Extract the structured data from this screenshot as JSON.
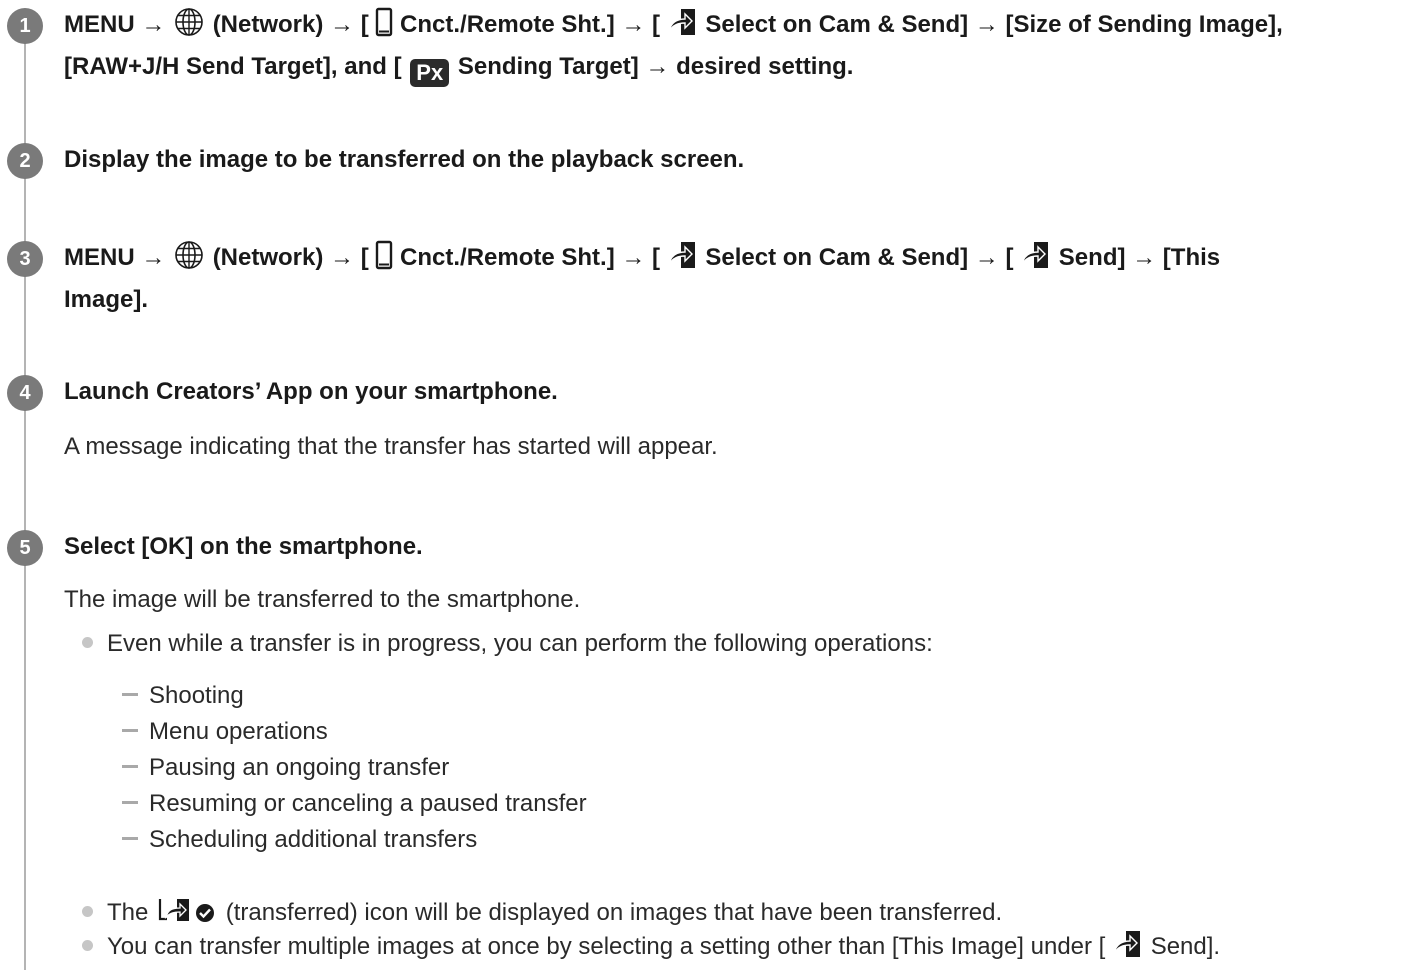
{
  "steps": [
    {
      "number": "1",
      "line1": {
        "t1": "MENU →",
        "t2": "(Network) → [",
        "t3": "Cnct./Remote Sht.] → [",
        "t4": "Select on Cam & Send] → [Size of Sending Image],"
      },
      "line2": {
        "t1": "[RAW+J/H Send Target], and [",
        "badge": "Px",
        "t2": "Sending Target] → desired setting."
      }
    },
    {
      "number": "2",
      "heading": "Display the image to be transferred on the playback screen."
    },
    {
      "number": "3",
      "line1": {
        "t1": "MENU →",
        "t2": "(Network) → [",
        "t3": "Cnct./Remote Sht.] → [",
        "t4": "Select on Cam & Send] → [",
        "t5": "Send] → [This"
      },
      "line2": "Image]."
    },
    {
      "number": "4",
      "heading": "Launch Creators’ App on your smartphone.",
      "body": "A message indicating that the transfer has started will appear."
    },
    {
      "number": "5",
      "heading": "Select [OK] on the smartphone.",
      "body": "The image will be transferred to the smartphone.",
      "bullet1": "Even while a transfer is in progress, you can perform the following operations:",
      "sub_items": [
        "Shooting",
        "Menu operations",
        "Pausing an ongoing transfer",
        "Resuming or canceling a paused transfer",
        "Scheduling additional transfers"
      ],
      "bullet2": {
        "t1": "The",
        "t2": "(transferred) icon will be displayed on images that have been transferred."
      },
      "bullet3": {
        "t1": "You can transfer multiple images at once by selecting a setting other than [This Image] under [",
        "t2": "Send]."
      }
    }
  ],
  "icons": {
    "network": "globe-icon",
    "remote": "smartphone-icon",
    "send": "send-to-smartphone-icon",
    "transferred": "transferred-check-icon"
  },
  "colors": {
    "step_circle": "#7a7a7a",
    "timeline": "#b4b4b4",
    "badge": "#2b2b2b"
  }
}
